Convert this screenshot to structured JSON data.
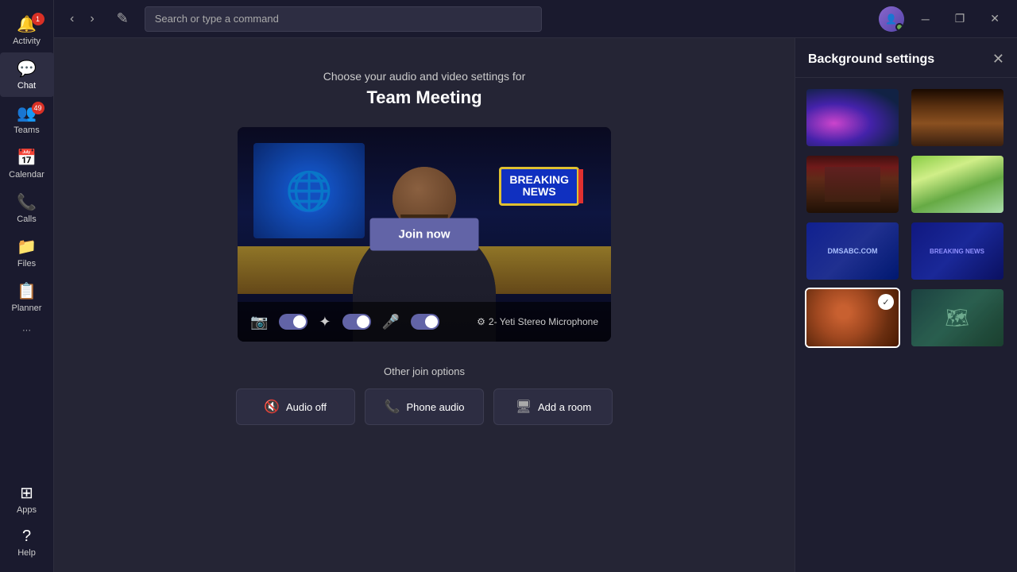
{
  "titlebar": {
    "search_placeholder": "Search or type a command",
    "compose_icon": "✎",
    "back_icon": "‹",
    "forward_icon": "›",
    "minimize_icon": "─",
    "maximize_icon": "❐",
    "close_icon": "✕"
  },
  "sidebar": {
    "items": [
      {
        "id": "activity",
        "label": "Activity",
        "icon": "🔔",
        "badge": "1"
      },
      {
        "id": "chat",
        "label": "Chat",
        "icon": "💬",
        "active": true
      },
      {
        "id": "teams",
        "label": "Teams",
        "icon": "👥",
        "badge": "49"
      },
      {
        "id": "calendar",
        "label": "Calendar",
        "icon": "📅"
      },
      {
        "id": "calls",
        "label": "Calls",
        "icon": "📞"
      },
      {
        "id": "files",
        "label": "Files",
        "icon": "📁"
      },
      {
        "id": "planner",
        "label": "Planner",
        "icon": "📋"
      },
      {
        "id": "more",
        "label": "···",
        "icon": ""
      }
    ],
    "bottom_items": [
      {
        "id": "apps",
        "label": "Apps",
        "icon": "⊞"
      },
      {
        "id": "help",
        "label": "Help",
        "icon": "?"
      }
    ]
  },
  "meeting": {
    "subtitle": "Choose your audio and video settings for",
    "title": "Team Meeting",
    "join_now_label": "Join now",
    "other_join_title": "Other join options",
    "join_options": [
      {
        "id": "audio-off",
        "label": "Audio off",
        "icon": "🔇"
      },
      {
        "id": "phone-audio",
        "label": "Phone audio",
        "icon": "📞"
      },
      {
        "id": "add-room",
        "label": "Add a room",
        "icon": "🖥"
      }
    ],
    "controls": {
      "camera_icon": "📷",
      "blur_icon": "✦",
      "mic_icon": "🎤",
      "gear_icon": "⚙",
      "mic_label": "2- Yeti Stereo Microphone"
    }
  },
  "bg_settings": {
    "title": "Background settings",
    "close_icon": "✕",
    "backgrounds": [
      {
        "id": "galaxy",
        "type": "galaxy",
        "selected": false
      },
      {
        "id": "canyon",
        "type": "canyon",
        "selected": false
      },
      {
        "id": "street",
        "type": "street",
        "selected": false
      },
      {
        "id": "cartoon",
        "type": "cartoon",
        "selected": false
      },
      {
        "id": "news1",
        "type": "news1",
        "label": "DMSABC.COM",
        "selected": false
      },
      {
        "id": "news2",
        "type": "news2",
        "label": "BREAKING NEWS",
        "selected": false
      },
      {
        "id": "pizza",
        "type": "pizza",
        "selected": true
      },
      {
        "id": "map",
        "type": "map",
        "label": "🗺",
        "selected": false
      }
    ]
  }
}
